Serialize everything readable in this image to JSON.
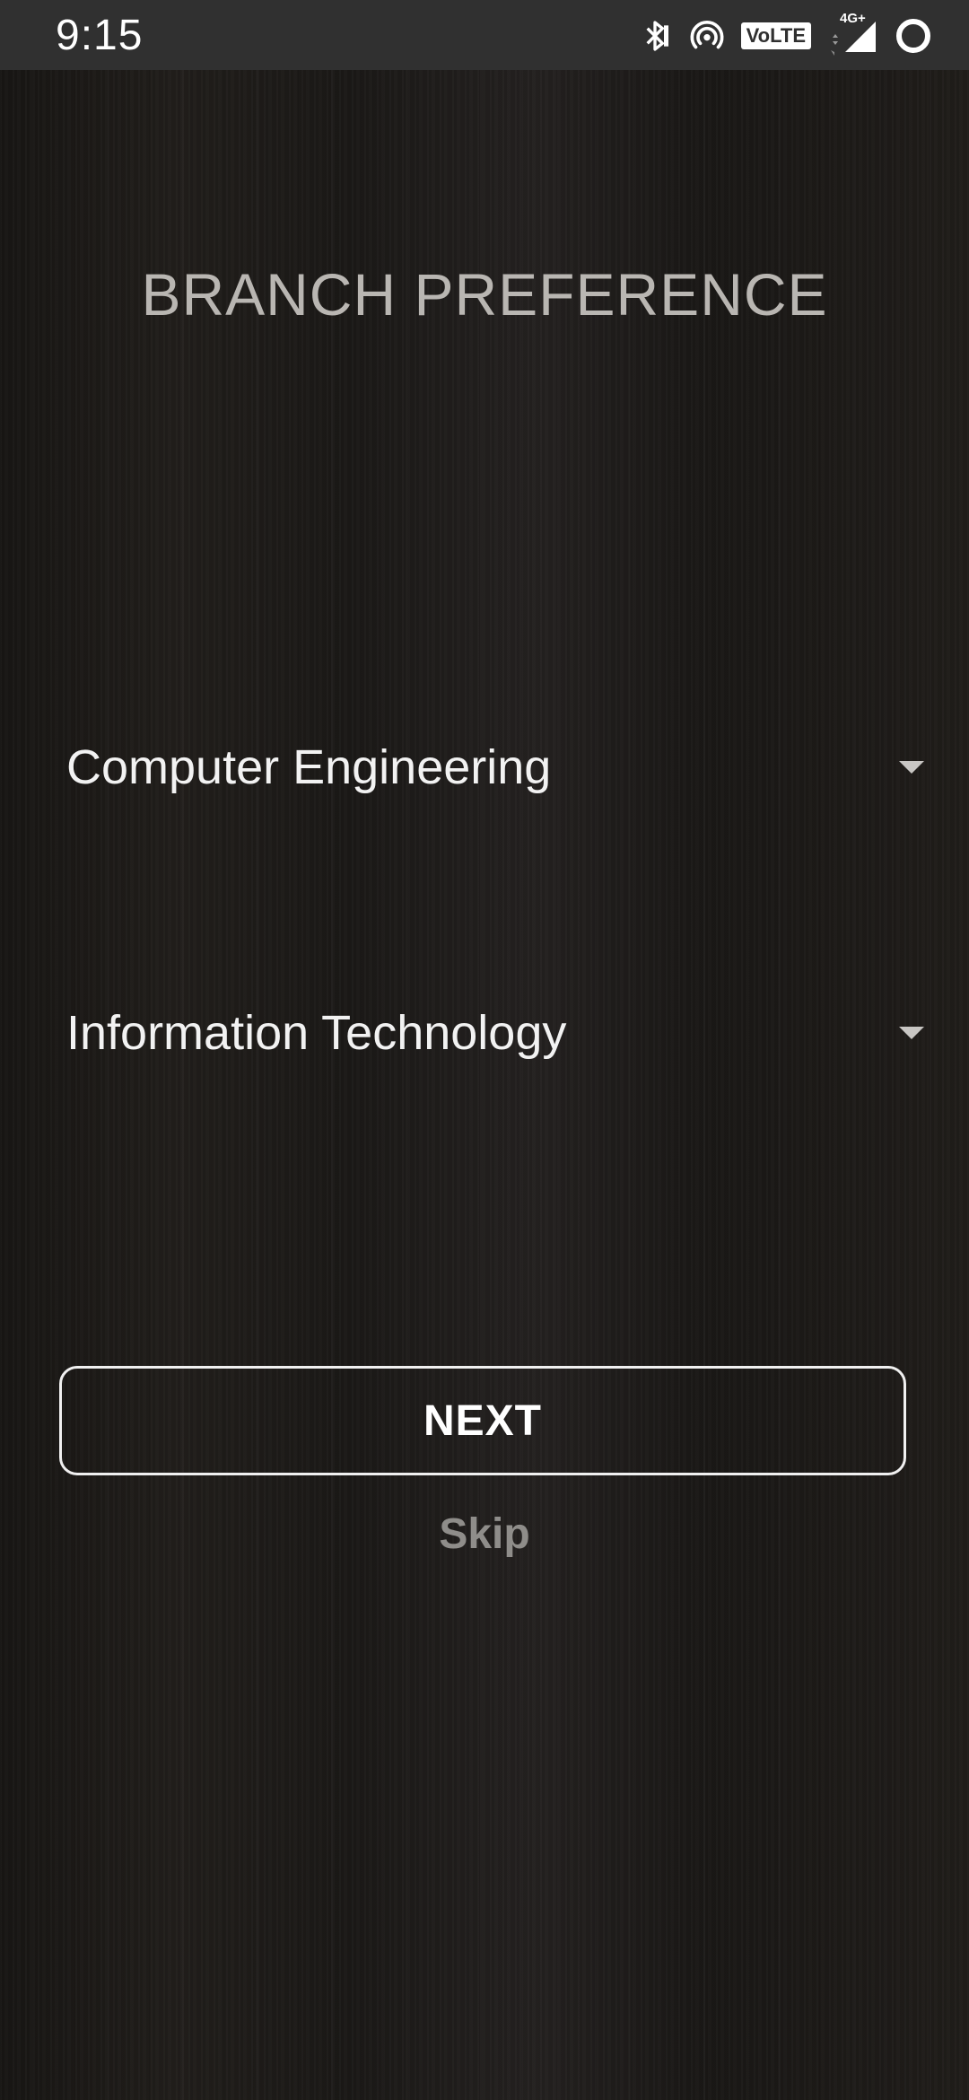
{
  "status_bar": {
    "time": "9:15",
    "volte_label": "VoLTE",
    "network_label": "4G+",
    "icons": [
      "bluetooth-icon",
      "hotspot-icon",
      "volte-icon",
      "signal-icon",
      "battery-icon"
    ]
  },
  "page": {
    "title": "BRANCH PREFERENCE"
  },
  "preferences": {
    "first": {
      "selected": "Computer Engineering"
    },
    "second": {
      "selected": "Information Technology"
    }
  },
  "actions": {
    "next_label": "NEXT",
    "skip_label": "Skip"
  },
  "colors": {
    "status_bar_bg": "#303030",
    "background": "#1d1b19",
    "title_color": "#b9b6b2",
    "skip_color": "#8f8d8a"
  }
}
